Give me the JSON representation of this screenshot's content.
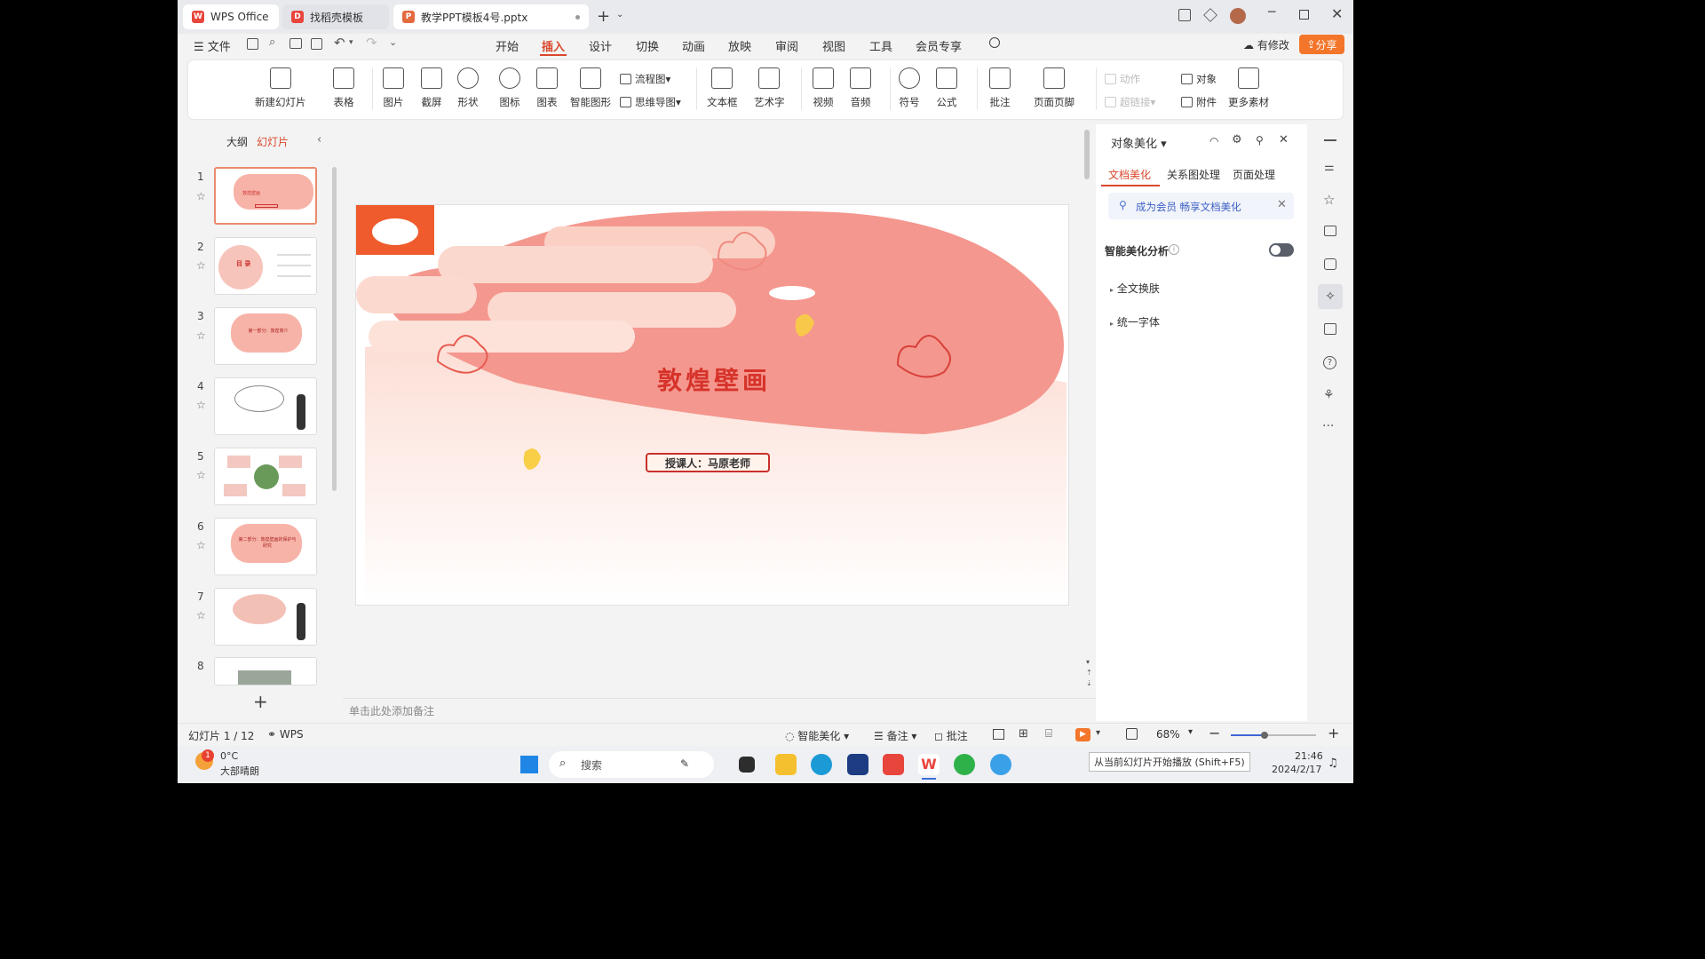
{
  "tabs": [
    {
      "label": "WPS Office"
    },
    {
      "label": "找稻壳模板"
    },
    {
      "label": "教学PPT模板4号.pptx"
    }
  ],
  "menu": {
    "file": "文件",
    "items": [
      "开始",
      "插入",
      "设计",
      "切换",
      "动画",
      "放映",
      "审阅",
      "视图",
      "工具",
      "会员专享"
    ],
    "active": "插入",
    "modify": "有修改",
    "share": "分享"
  },
  "ribbon": {
    "new_slide": "新建幻灯片",
    "table": "表格",
    "picture": "图片",
    "screenshot": "截屏",
    "shape": "形状",
    "icon": "图标",
    "chart": "图表",
    "smart_graphic": "智能图形",
    "flowchart": "流程图",
    "mindmap": "思维导图",
    "textbox": "文本框",
    "wordart": "艺术字",
    "video": "视频",
    "audio": "音频",
    "symbol": "符号",
    "formula": "公式",
    "comment": "批注",
    "header_footer": "页面页脚",
    "action": "动作",
    "hyperlink": "超链接",
    "object": "对象",
    "attachment": "附件",
    "more_material": "更多素材"
  },
  "left_panel": {
    "tab_outline": "大纲",
    "tab_slides": "幻灯片",
    "slides": [
      "1",
      "2",
      "3",
      "4",
      "5",
      "6",
      "7",
      "8"
    ],
    "thumb_texts": [
      "敦煌壁画",
      "目 录",
      "第一部分：敦煌简介",
      "",
      "",
      "第二部分：敦煌壁画的保护与研究",
      "",
      ""
    ]
  },
  "slide": {
    "title": "敦煌壁画",
    "presenter": "授课人：马原老师"
  },
  "notes_placeholder": "单击此处添加备注",
  "right_panel": {
    "title": "对象美化",
    "tabs": [
      "文档美化",
      "关系图处理",
      "页面处理"
    ],
    "banner": "成为会员 畅享文档美化",
    "smart_label": "智能美化分析",
    "items": [
      "全文换肤",
      "统一字体"
    ]
  },
  "status": {
    "slide_info": "幻灯片 1 / 12",
    "theme": "WPS",
    "smart": "智能美化",
    "notes": "备注",
    "comment": "批注",
    "zoom": "68%",
    "tooltip": "从当前幻灯片开始播放 (Shift+F5)",
    "zoom_level": 0.4
  },
  "taskbar": {
    "temp": "0°C",
    "weather": "大部晴朗",
    "badge": "1",
    "search": "搜索",
    "time": "21:46",
    "date": "2024/2/17"
  },
  "colors": {
    "accent": "#d9482c",
    "share_btn": "#f3762b",
    "slide_pink": "#f4978e",
    "title_red": "#d6332a"
  }
}
